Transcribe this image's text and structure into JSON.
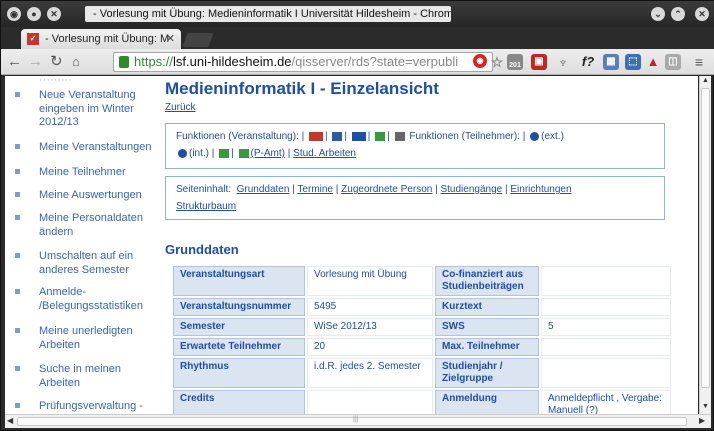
{
  "window": {
    "title": "- Vorlesung mit Übung: Medieninformatik I Universität Hildesheim - Chromium"
  },
  "tab": {
    "label": "- Vorlesung mit Übung: M"
  },
  "omnibox": {
    "scheme": "https://",
    "host": "lsf.uni-hildesheim.de",
    "path": "/qisserver/rds?state=verpubli"
  },
  "extensions": {
    "badge_count": "201"
  },
  "sidebar": {
    "items": [
      {
        "label": "Neue Veranstaltung\neingeben im Winter\n2012/13"
      },
      {
        "label": "Meine Veranstaltungen"
      },
      {
        "label": "Meine Teilnehmer"
      },
      {
        "label": "Meine Auswertungen"
      },
      {
        "label": "Meine Personaldaten\nändern"
      },
      {
        "label": "Umschalten auf ein\nanderes Semester"
      },
      {
        "label": "Anmelde-\n/Belegungsstatistiken"
      },
      {
        "label": "Meine unerledigten\nArbeiten"
      },
      {
        "label": "Suche in meinen\nArbeiten"
      },
      {
        "label": "Prüfungsverwaltung -"
      }
    ]
  },
  "page": {
    "title": "Medieninformatik I - Einzelansicht",
    "back_link": "Zurück",
    "functions_label": "Funktionen (Veranstaltung):",
    "functions_participants_label": "Funktionen (Teilnehmer):",
    "ext_link": "(ext.)",
    "int_link": "(int.)",
    "p_amt_link": "(P-Amt)",
    "stud_arbeiten_link": "Stud. Arbeiten",
    "content_label": "Seiteninhalt:",
    "content_links": [
      "Grunddaten",
      "Termine",
      "Zugeordnete Person",
      "Studiengänge",
      "Einrichtungen",
      "Strukturbaum"
    ],
    "section_title": "Grunddaten"
  },
  "details": {
    "rows": [
      {
        "l1": "Veranstaltungsart",
        "v1": "Vorlesung mit Übung",
        "l2": "Co-finanziert aus Studienbeiträgen",
        "v2": ""
      },
      {
        "l1": "Veranstaltungsnummer",
        "v1": "5495",
        "l2": "Kurztext",
        "v2": ""
      },
      {
        "l1": "Semester",
        "v1": "WiSe 2012/13",
        "l2": "SWS",
        "v2": "5"
      },
      {
        "l1": "Erwartete Teilnehmer",
        "v1": "20",
        "l2": "Max. Teilnehmer",
        "v2": ""
      },
      {
        "l1": "Rhythmus",
        "v1": "i.d.R. jedes 2. Semester",
        "l2": "Studienjahr / Zielgruppe",
        "v2": ""
      },
      {
        "l1": "Credits",
        "v1": "",
        "l2": "Anmeldung",
        "v2": "Anmeldepflicht , Vergabe: Manuell (?)"
      }
    ]
  },
  "colors": {
    "link_blue": "#1f4ea3",
    "header_cell": "#dbe5f1",
    "secure_green": "#2e8b2e"
  }
}
